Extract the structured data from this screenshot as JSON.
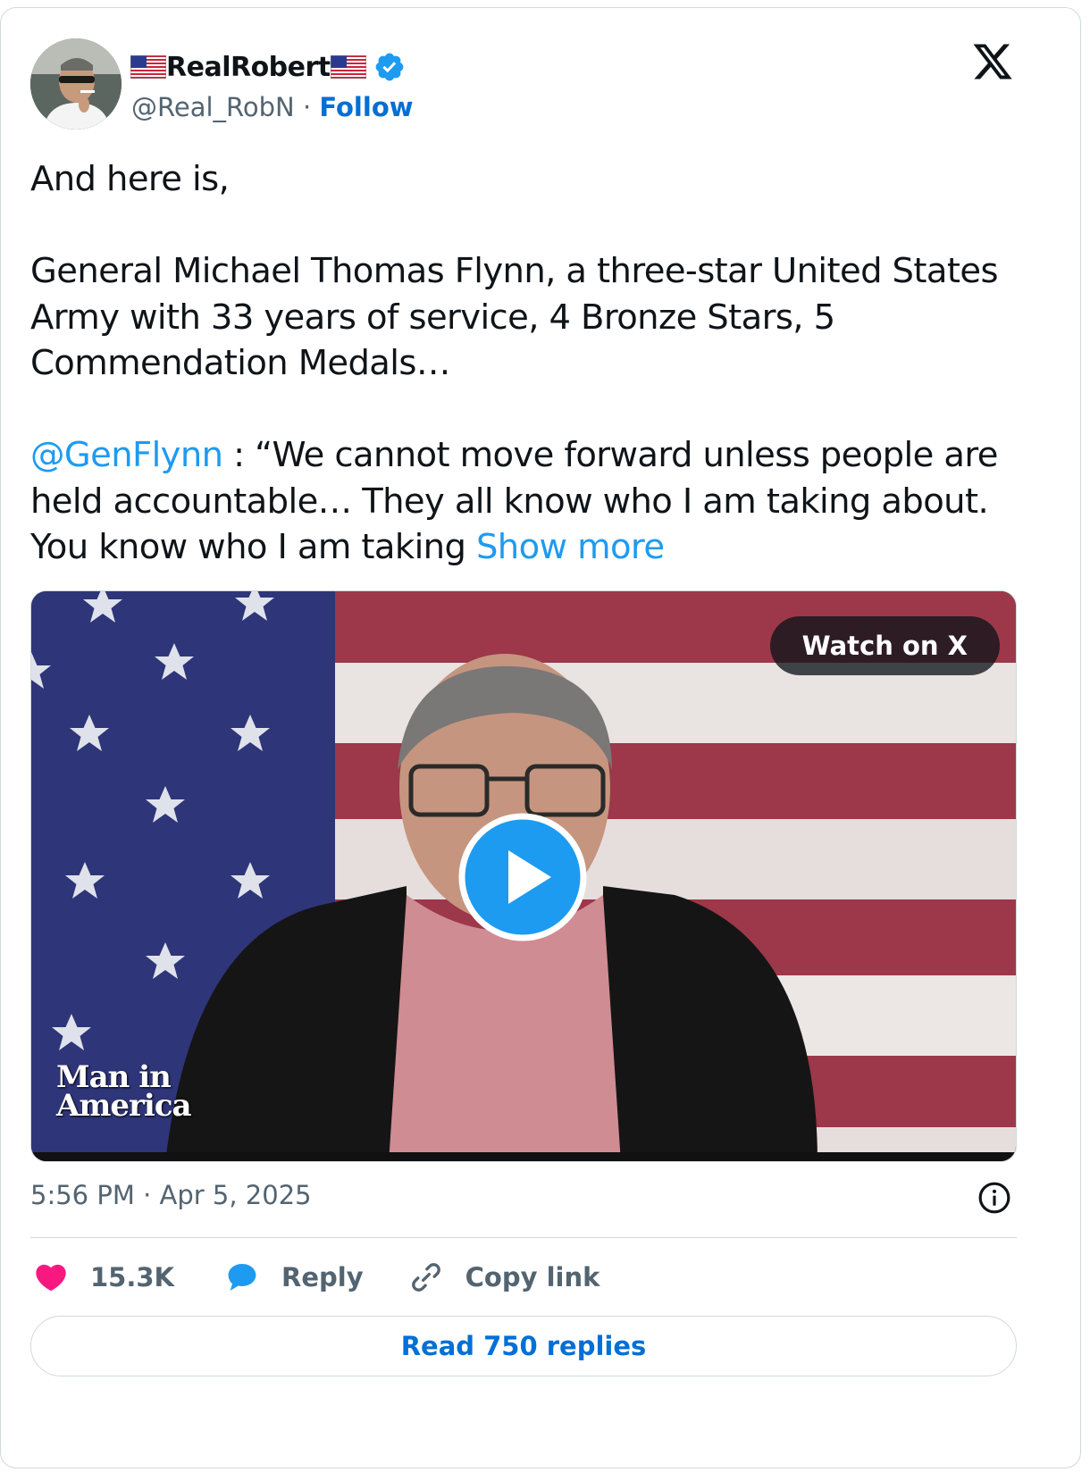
{
  "author": {
    "display_name": "RealRobert",
    "handle": "@Real_RobN",
    "separator": "·",
    "follow_label": "Follow",
    "verified": true
  },
  "tweet": {
    "line1": "And here is,",
    "para2": "General Michael Thomas Flynn, a three-star United States Army with 33 years of service, 4 Bronze Stars, 5 Commendation Medals…",
    "mention": "@GenFlynn",
    "para3_rest": " : “We cannot move forward unless people are held accountable… They all know who I am taking about. You know who I am taking ",
    "show_more": "Show more"
  },
  "media": {
    "watch_label": "Watch on X",
    "watermark_line1": "Man in",
    "watermark_line2": "America"
  },
  "meta": {
    "time": "5:56 PM",
    "separator": "·",
    "date": "Apr 5, 2025"
  },
  "actions": {
    "likes": "15.3K",
    "reply": "Reply",
    "copy_link": "Copy link"
  },
  "read_replies": "Read 750 replies",
  "colors": {
    "accent": "#1d9bf0",
    "link_blue": "#006fd6",
    "heart": "#f91880",
    "muted": "#536471"
  }
}
